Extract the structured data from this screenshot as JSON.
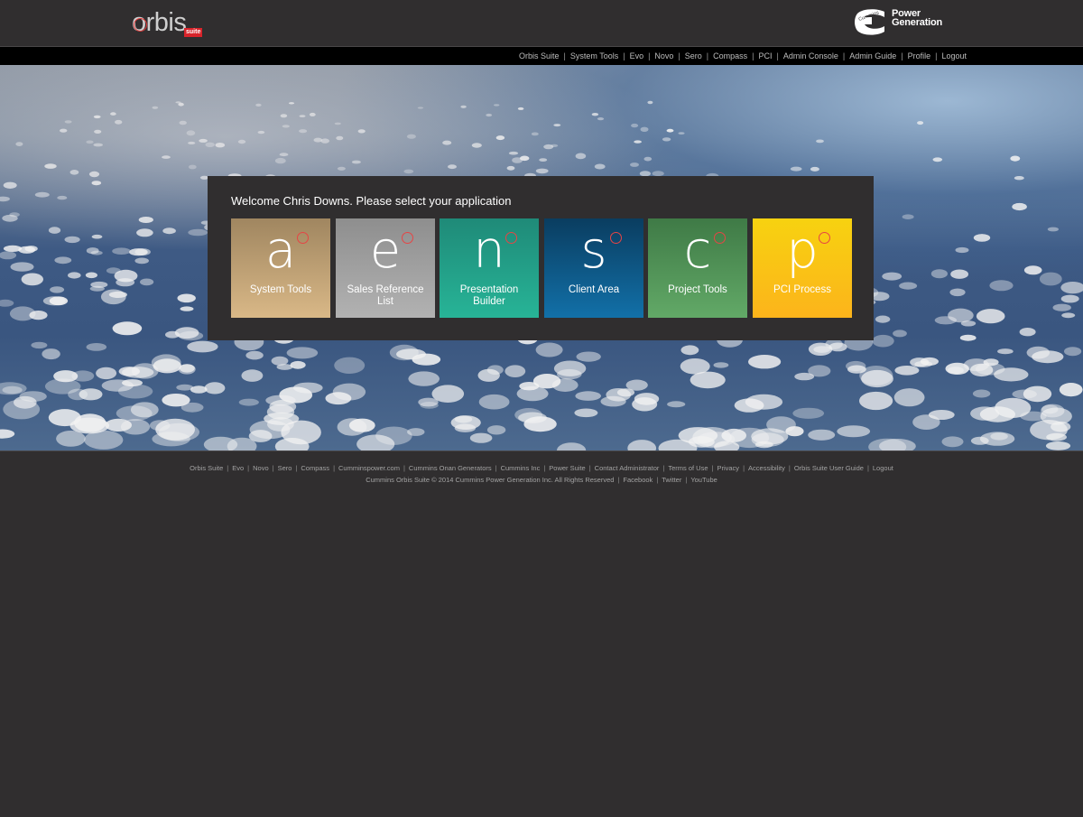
{
  "header": {
    "logo": {
      "word": "orbis",
      "badge": "suite",
      "accent_color": "#d8232a"
    },
    "brand": {
      "mark_name": "cummins-logo",
      "line1": "Power",
      "line2": "Generation"
    }
  },
  "top_nav": {
    "links": [
      "Orbis Suite",
      "System Tools",
      "Evo",
      "Novo",
      "Sero",
      "Compass",
      "PCI",
      "Admin Console",
      "Admin Guide",
      "Profile",
      "Logout"
    ],
    "separator": "|"
  },
  "panel": {
    "welcome": "Welcome Chris Downs. Please select your application",
    "tiles": [
      {
        "letter": "a",
        "label": "System Tools",
        "colors": [
          "#a08660",
          "#d9b887"
        ]
      },
      {
        "letter": "e",
        "label": "Sales Reference List",
        "colors": [
          "#8e8e8e",
          "#b2b2b2"
        ]
      },
      {
        "letter": "n",
        "label": "Presentation Builder",
        "colors": [
          "#1f8a78",
          "#27b497"
        ]
      },
      {
        "letter": "s",
        "label": "Client Area",
        "colors": [
          "#0a3d60",
          "#1270a8"
        ]
      },
      {
        "letter": "c",
        "label": "Project Tools",
        "colors": [
          "#3f7a46",
          "#62a967"
        ]
      },
      {
        "letter": "p",
        "label": "PCI Process",
        "colors": [
          "#f7d210",
          "#fcb41b"
        ]
      }
    ]
  },
  "footer": {
    "links": [
      "Orbis Suite",
      "Evo",
      "Novo",
      "Sero",
      "Compass",
      "Cumminspower.com",
      "Cummins Onan Generators",
      "Cummins Inc",
      "Power Suite",
      "Contact Administrator",
      "Terms of Use",
      "Privacy",
      "Accessibility",
      "Orbis Suite User Guide",
      "Logout"
    ],
    "copyright": "Cummins Orbis Suite © 2014 Cummins Power Generation Inc. All Rights Reserved",
    "social": [
      "Facebook",
      "Twitter",
      "YouTube"
    ],
    "separator": "|"
  }
}
